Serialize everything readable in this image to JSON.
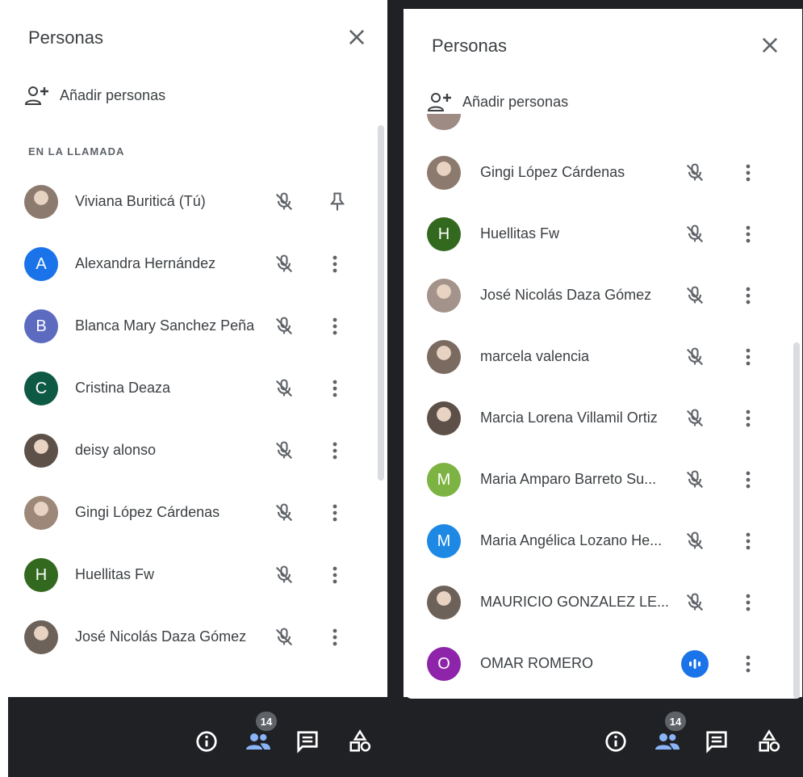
{
  "panel": {
    "title": "Personas",
    "add_people_label": "Añadir personas",
    "section_label": "EN LA LLAMADA"
  },
  "left_list": [
    {
      "name": "Viviana Buriticá (Tú)",
      "avatar": "photo"
    },
    {
      "name": "Alexandra Hernández",
      "avatar": "A",
      "color": "#1a73e8"
    },
    {
      "name": "Blanca Mary Sanchez Peña",
      "avatar": "B",
      "color": "#5c6bc0"
    },
    {
      "name": "Cristina Deaza",
      "avatar": "C",
      "color": "#0d5943"
    },
    {
      "name": "deisy alonso",
      "avatar": "photo"
    },
    {
      "name": "Gingi López Cárdenas",
      "avatar": "photo"
    },
    {
      "name": "Huellitas Fw",
      "avatar": "H",
      "color": "#33691e"
    },
    {
      "name": "José Nicolás Daza Gómez",
      "avatar": "photo"
    }
  ],
  "right_list": [
    {
      "name": "Gingi López Cárdenas",
      "avatar": "photo"
    },
    {
      "name": "Huellitas Fw",
      "avatar": "H",
      "color": "#33691e"
    },
    {
      "name": "José Nicolás Daza Gómez",
      "avatar": "photo"
    },
    {
      "name": "marcela valencia",
      "avatar": "photo"
    },
    {
      "name": "Marcia Lorena Villamil Ortiz",
      "avatar": "photo"
    },
    {
      "name": "Maria Amparo Barreto Su...",
      "avatar": "M",
      "color": "#7cb342"
    },
    {
      "name": "Maria Angélica Lozano He...",
      "avatar": "M",
      "color": "#1e88e5"
    },
    {
      "name": "MAURICIO GONZALEZ LE...",
      "avatar": "photo"
    },
    {
      "name": "OMAR ROMERO",
      "avatar": "O",
      "color": "#8e24aa"
    }
  ],
  "toolbar": {
    "participant_count": "14",
    "icons": [
      "info-icon",
      "people-icon",
      "chat-icon",
      "activities-icon"
    ],
    "active_color": "#8ab4f8"
  }
}
